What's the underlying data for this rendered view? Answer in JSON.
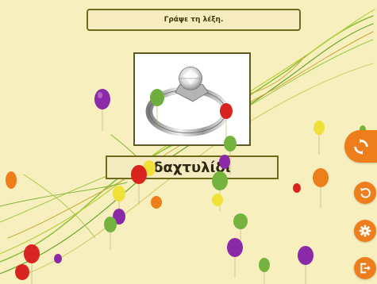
{
  "instruction": "Γράψε τη λέξη.",
  "answer_text": "δαχτυλίδι",
  "picture": {
    "subject": "ring"
  },
  "colors": {
    "background": "#f7efbd",
    "accent": "#ee7d1b",
    "border": "#6f6a1c"
  },
  "buttons": [
    {
      "name": "refresh-button",
      "icon": "refresh-icon"
    },
    {
      "name": "restart-button",
      "icon": "undo-icon"
    },
    {
      "name": "settings-button",
      "icon": "gear-icon"
    },
    {
      "name": "exit-button",
      "icon": "exit-icon"
    }
  ]
}
